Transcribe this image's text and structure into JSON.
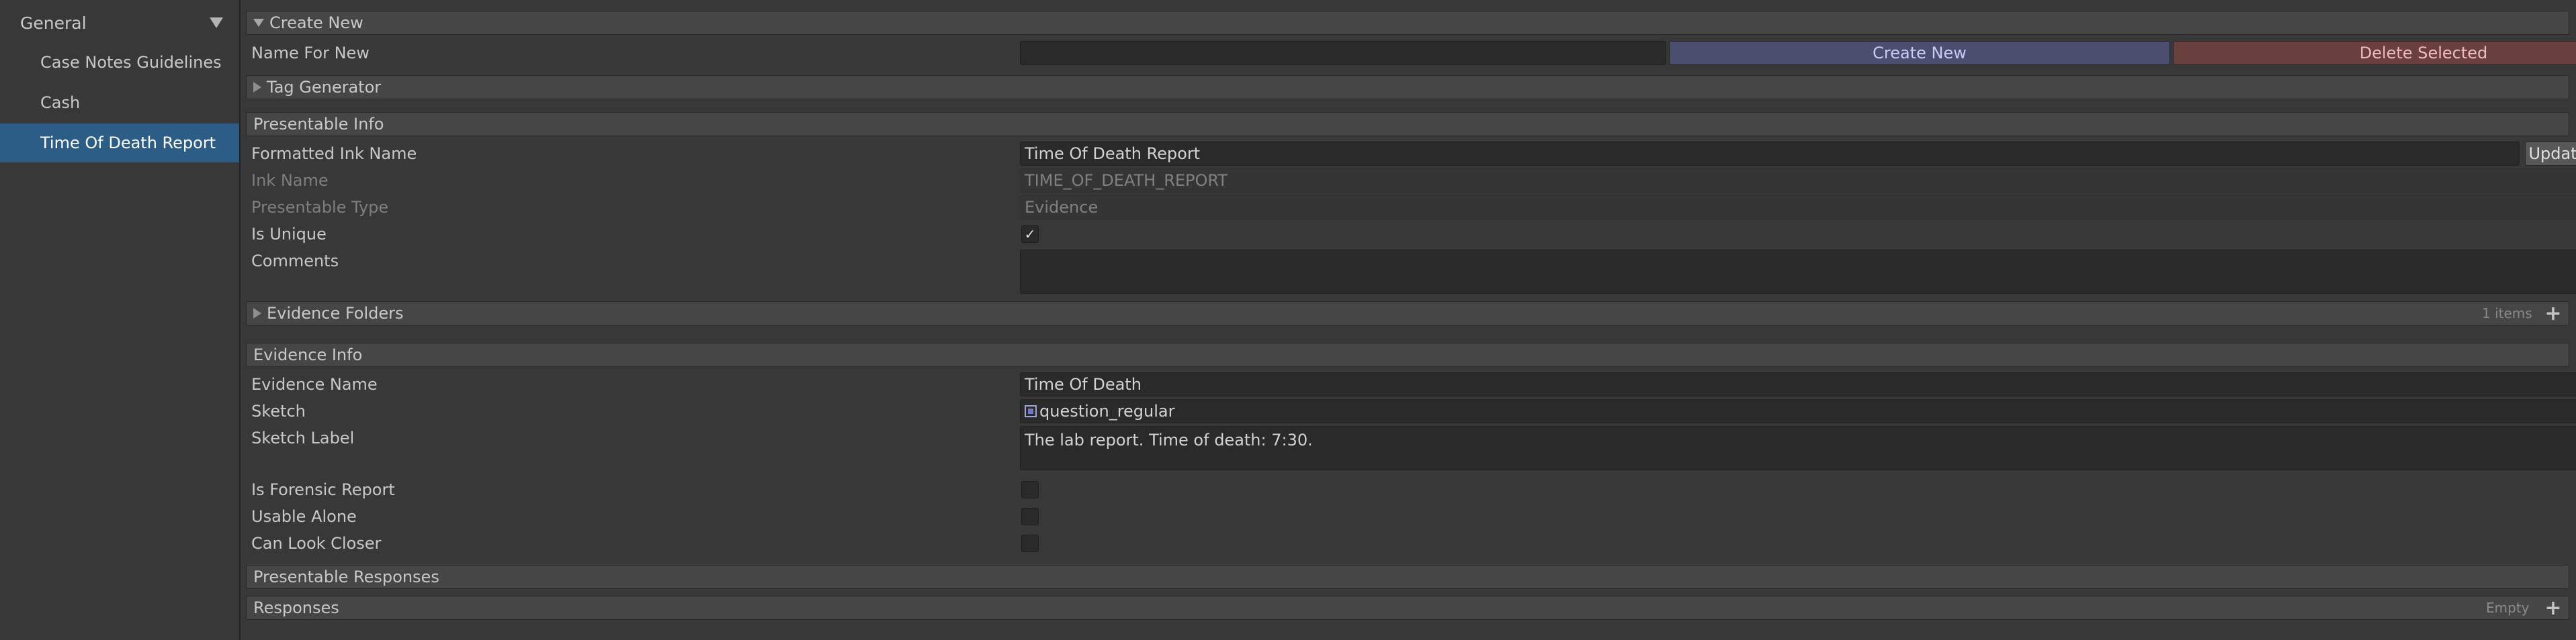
{
  "sidebar": {
    "group_label": "General",
    "items": [
      {
        "label": "Case Notes Guidelines"
      },
      {
        "label": "Cash"
      },
      {
        "label": "Time Of Death Report"
      }
    ]
  },
  "create_new": {
    "header": "Create New",
    "name_label": "Name For New",
    "name_value": "",
    "create_button": "Create New",
    "delete_button": "Delete Selected"
  },
  "tag_generator": {
    "header": "Tag Generator"
  },
  "presentable_info": {
    "header": "Presentable Info",
    "formatted_ink_name_label": "Formatted Ink Name",
    "formatted_ink_name_value": "Time Of Death Report",
    "update_button": "Update SO Name",
    "ink_name_label": "Ink Name",
    "ink_name_value": "TIME_OF_DEATH_REPORT",
    "presentable_type_label": "Presentable Type",
    "presentable_type_value": "Evidence",
    "is_unique_label": "Is Unique",
    "is_unique_check": "✓",
    "comments_label": "Comments",
    "comments_value": "",
    "evidence_folders_label": "Evidence Folders",
    "evidence_folders_count": "1 items",
    "add_symbol": "+"
  },
  "evidence_info": {
    "header": "Evidence Info",
    "evidence_name_label": "Evidence Name",
    "evidence_name_value": "Time Of Death",
    "sketch_label": "Sketch",
    "sketch_value": "question_regular",
    "sketch_label_label": "Sketch Label",
    "sketch_label_value": "The lab report. Time of death: 7:30.",
    "is_forensic_label": "Is Forensic Report",
    "usable_alone_label": "Usable Alone",
    "can_look_closer_label": "Can Look Closer",
    "is_forensic_checked": false,
    "usable_alone_checked": false,
    "can_look_closer_checked": false
  },
  "presentable_responses": {
    "header": "Presentable Responses",
    "responses_label": "Responses",
    "responses_empty": "Empty",
    "add_symbol": "+"
  },
  "icons": {
    "foldout_expanded": "triangle-down",
    "foldout_collapsed": "triangle-right",
    "sketch_sprite": "sprite-icon",
    "edit": "pencil-icon",
    "object_picker": "target-icon"
  },
  "colors": {
    "selection": "#2c5d87",
    "create_button": "#4b4e6e",
    "delete_button": "#6a3f3f"
  }
}
